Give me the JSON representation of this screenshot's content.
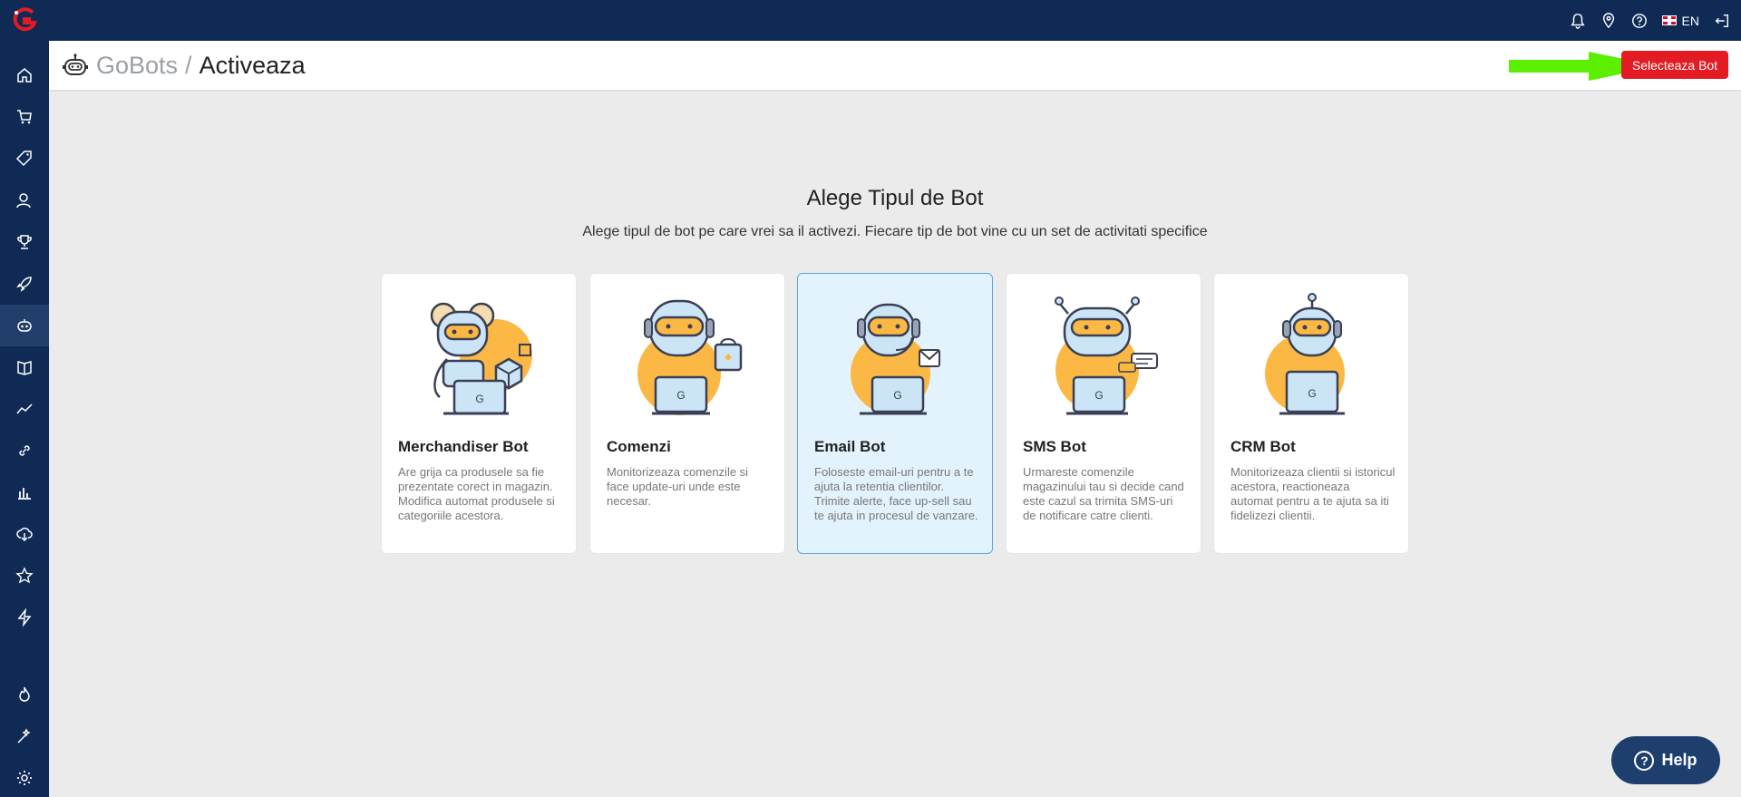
{
  "topbar": {
    "language": "EN"
  },
  "header": {
    "breadcrumb_parent": "GoBots",
    "breadcrumb_separator": "/",
    "breadcrumb_current": "Activeaza",
    "select_button": "Selecteaza Bot"
  },
  "main": {
    "title": "Alege Tipul de Bot",
    "subtitle": "Alege tipul de bot pe care vrei sa il activezi. Fiecare tip de bot vine cu un set de activitati specifice"
  },
  "cards": [
    {
      "name": "Merchandiser Bot",
      "description": "Are grija ca produsele sa fie prezentate corect in magazin. Modifica automat produsele si categoriile acestora."
    },
    {
      "name": "Comenzi",
      "description": "Monitorizeaza comenzile si face update-uri unde este necesar."
    },
    {
      "name": "Email Bot",
      "description": "Foloseste email-uri pentru a te ajuta la retentia clientilor. Trimite alerte, face up-sell sau te ajuta in procesul de vanzare."
    },
    {
      "name": "SMS Bot",
      "description": "Urmareste comenzile magazinului tau si decide cand este cazul sa trimita SMS-uri de notificare catre clienti."
    },
    {
      "name": "CRM Bot",
      "description": "Monitorizeaza clientii si istoricul acestora, reactioneaza automat pentru a te ajuta sa iti fidelizezi clientii."
    }
  ],
  "help": {
    "label": "Help"
  },
  "colors": {
    "navy": "#0e2a55",
    "accent_red": "#e31b23",
    "arrow_green": "#5cf000",
    "selected_card": "#e3f3fd",
    "robot_orange": "#fcb845"
  },
  "icons": {
    "sidebar": [
      "home-icon",
      "cart-icon",
      "tag-icon",
      "users-icon",
      "trophy-icon",
      "rocket-icon",
      "robot-icon",
      "book-icon",
      "trend-icon",
      "link-icon",
      "bar-chart-icon",
      "cloud-download-icon",
      "star-icon",
      "lightning-icon",
      "fire-icon",
      "magic-wand-icon",
      "settings-icon"
    ],
    "topbar": [
      "bell-icon",
      "location-icon",
      "help-circle-icon",
      "uk-flag-icon",
      "logout-icon"
    ]
  }
}
